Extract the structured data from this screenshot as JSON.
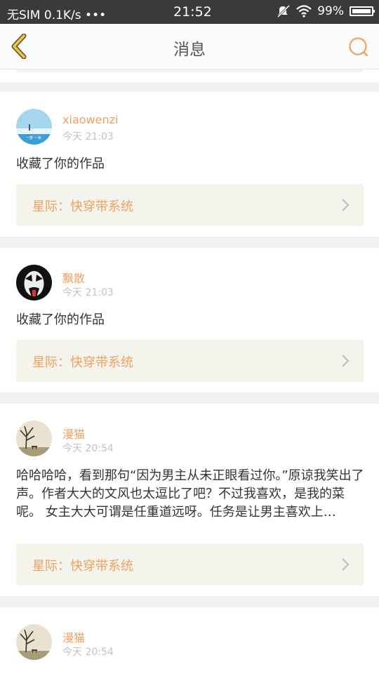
{
  "status_bar": {
    "carrier": "无SIM 0.1K/s •••",
    "time": "21:52",
    "battery": "99%"
  },
  "nav": {
    "title": "消息"
  },
  "colors": {
    "accent": "#f0a060",
    "card_bg": "#ffffff",
    "work_bg": "#f4f4ec",
    "page_bg": "#f1f1f1"
  },
  "messages": [
    {
      "user": "xiaowenzi",
      "time": "今天 21:03",
      "text": "收藏了你的作品",
      "work": "星际：快穿带系统",
      "avatar_icon": "beach-sky-avatar"
    },
    {
      "user": "飘散",
      "time": "今天 21:03",
      "text": "收藏了你的作品",
      "work": "星际：快穿带系统",
      "avatar_icon": "kiss-face-avatar"
    },
    {
      "user": "漫猫",
      "time": "今天 20:54",
      "text": "哈哈哈哈，看到那句“因为男主从未正眼看过你。”原谅我笑出了声。作者大大的文风也太逗比了吧？不过我喜欢，是我的菜呢。 女主大大可谓是任重道远呀。任务是让男主喜欢上…",
      "work": "星际：快穿带系统",
      "avatar_icon": "tree-bench-avatar"
    },
    {
      "user": "漫猫",
      "time": "今天 20:54",
      "avatar_icon": "tree-bench-avatar"
    }
  ]
}
